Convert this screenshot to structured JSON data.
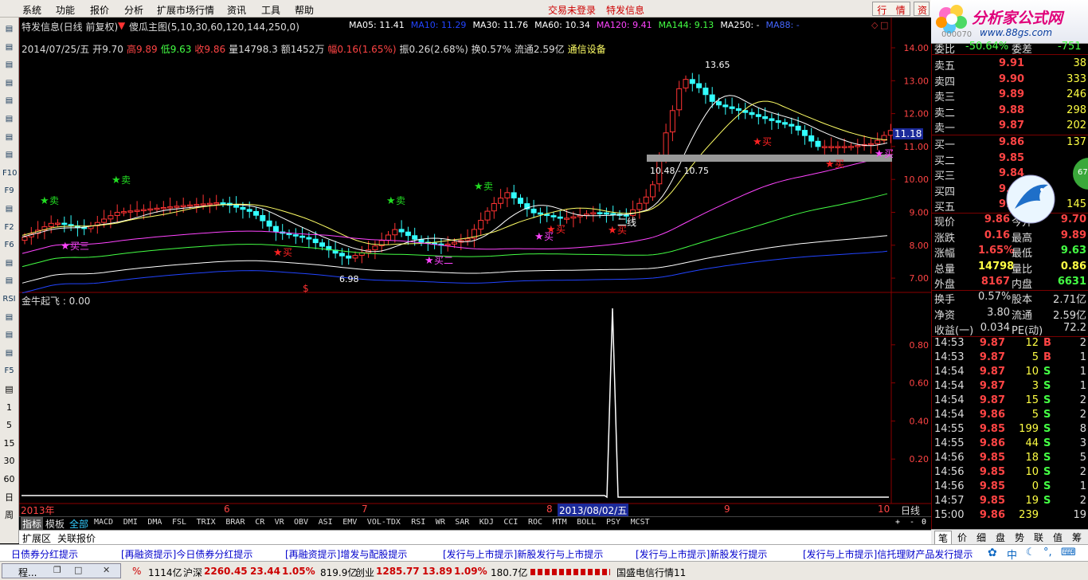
{
  "menu": {
    "items": [
      "系统",
      "功能",
      "报价",
      "分析",
      "扩展市场行情",
      "资讯",
      "工具",
      "帮助"
    ],
    "login": "交易未登录",
    "news": "特发信息",
    "btn1": "行",
    "btn2": "情",
    "btn3": "资"
  },
  "logo": {
    "text": "分析家公式网",
    "url": "www.88gs.com",
    "code": "000070"
  },
  "chart": {
    "title": "特发信息(日线 前复权)",
    "main_formula": "傻瓜主图",
    "main_params": "(5,10,30,60,120,144,250,0)",
    "ma_labels": [
      {
        "t": "MA05: 11.41",
        "c": "#ffffff"
      },
      {
        "t": "MA10: 11.29",
        "c": "#2244ff"
      },
      {
        "t": "MA30: 11.76",
        "c": "#ffffff"
      },
      {
        "t": "MA60: 10.34",
        "c": "#ffffff"
      },
      {
        "t": "MA120: 9.41",
        "c": "#ff44ff"
      },
      {
        "t": "MA144: 9.13",
        "c": "#44ff44"
      },
      {
        "t": "MA250: -",
        "c": "#ffffff"
      },
      {
        "t": "MA88: -",
        "c": "#4466ff"
      }
    ],
    "info": [
      {
        "t": "2014/07/25/五",
        "c": "#dddddd"
      },
      {
        "t": "开9.70",
        "c": "#dddddd"
      },
      {
        "t": "高9.89",
        "c": "#ff4444"
      },
      {
        "t": "低9.63",
        "c": "#44ff44"
      },
      {
        "t": "收9.86",
        "c": "#ff4444"
      },
      {
        "t": "量14798.3",
        "c": "#dddddd"
      },
      {
        "t": "额1452万",
        "c": "#dddddd"
      },
      {
        "t": "幅0.16(1.65%)",
        "c": "#ff4444"
      },
      {
        "t": "振0.26(2.68%)",
        "c": "#dddddd"
      },
      {
        "t": "换0.57%",
        "c": "#dddddd"
      },
      {
        "t": "流通2.59亿",
        "c": "#dddddd"
      },
      {
        "t": "通信设备",
        "c": "#ffff66"
      }
    ],
    "price_ticks": [
      "14.00",
      "13.00",
      "12.00",
      "11.00",
      "10.00",
      "9.00",
      "8.00",
      "7.00"
    ],
    "current_price_tag": "11.18",
    "annotations": {
      "high": "13.65",
      "low": "6.98",
      "range": "10.48 - 10.75",
      "erxian": "二线"
    },
    "signals": [
      {
        "t": "卖",
        "x": 62,
        "y": 252,
        "c": "#22dd22"
      },
      {
        "t": "卖",
        "x": 152,
        "y": 226,
        "c": "#22dd22"
      },
      {
        "t": "卖",
        "x": 497,
        "y": 252,
        "c": "#22dd22"
      },
      {
        "t": "卖",
        "x": 607,
        "y": 234,
        "c": "#22dd22"
      },
      {
        "t": "买三",
        "x": 88,
        "y": 309,
        "c": "#ff44ff"
      },
      {
        "t": "买",
        "x": 355,
        "y": 317,
        "c": "#ff2222"
      },
      {
        "t": "买二",
        "x": 545,
        "y": 327,
        "c": "#ff44ff"
      },
      {
        "t": "买",
        "x": 698,
        "y": 288,
        "c": "#ff2222"
      },
      {
        "t": "买",
        "x": 683,
        "y": 297,
        "c": "#ff44ff"
      },
      {
        "t": "买",
        "x": 775,
        "y": 289,
        "c": "#ff2222"
      },
      {
        "t": "买",
        "x": 957,
        "y": 178,
        "c": "#ff2222"
      },
      {
        "t": "买",
        "x": 1048,
        "y": 206,
        "c": "#ff2222"
      },
      {
        "t": "买",
        "x": 1110,
        "y": 193,
        "c": "#ff44ff"
      }
    ],
    "dollar": "$",
    "sub_title": "金牛起飞 : 0.00",
    "sub_ticks": [
      "0.80",
      "0.60",
      "0.40",
      "0.20"
    ],
    "x_labels": [
      {
        "t": "2013年",
        "c": "#ff4444"
      },
      {
        "t": "6",
        "c": "#ff4444"
      },
      {
        "t": "7",
        "c": "#ff4444"
      },
      {
        "t": "8",
        "c": "#ff4444"
      },
      {
        "t": "9",
        "c": "#ff4444"
      },
      {
        "t": "10",
        "c": "#ff4444"
      }
    ],
    "date_highlight": "2013/08/02/五",
    "sub_right": "日线"
  },
  "chart_data": {
    "type": "candlestick",
    "symbol": "特发信息",
    "yticks": [
      14,
      13,
      12,
      11,
      10,
      9,
      8,
      7
    ],
    "indicator": "金牛起飞",
    "indicator_ticks": [
      0.8,
      0.6,
      0.4,
      0.2
    ],
    "indicator_peak": 1.0
  },
  "tabs": {
    "left": [
      "指标",
      "模板",
      "全部"
    ],
    "indicators": [
      "MACD",
      "DMI",
      "DMA",
      "FSL",
      "TRIX",
      "BRAR",
      "CR",
      "VR",
      "OBV",
      "ASI",
      "EMV",
      "VOL-TDX",
      "RSI",
      "WR",
      "SAR",
      "KDJ",
      "CCI",
      "ROC",
      "MTM",
      "BOLL",
      "PSY",
      "MCST"
    ],
    "ext": [
      "扩展区",
      "关联报价"
    ],
    "right": [
      "+",
      "-",
      "0"
    ]
  },
  "orderbook": {
    "header": {
      "l": "委比",
      "v": "-50.64%",
      "l2": "委差",
      "v2": "-751"
    },
    "sell": [
      {
        "l": "卖五",
        "p": "9.91",
        "v": "38"
      },
      {
        "l": "卖四",
        "p": "9.90",
        "v": "333"
      },
      {
        "l": "卖三",
        "p": "9.89",
        "v": "246"
      },
      {
        "l": "卖二",
        "p": "9.88",
        "v": "298"
      },
      {
        "l": "卖一",
        "p": "9.87",
        "v": "202"
      }
    ],
    "buy": [
      {
        "l": "买一",
        "p": "9.86",
        "v": "137"
      },
      {
        "l": "买二",
        "p": "9.85",
        "v": ""
      },
      {
        "l": "买三",
        "p": "9.84",
        "v": ""
      },
      {
        "l": "买四",
        "p": "9.83",
        "v": ""
      },
      {
        "l": "买五",
        "p": "9.82",
        "v": "145"
      }
    ],
    "stats": [
      {
        "l": "现价",
        "v": "9.86",
        "vc": "#ff4444",
        "l2": "今开",
        "v2": "9.70",
        "v2c": "#ff4444"
      },
      {
        "l": "涨跌",
        "v": "0.16",
        "vc": "#ff4444",
        "l2": "最高",
        "v2": "9.89",
        "v2c": "#ff4444"
      },
      {
        "l": "涨幅",
        "v": "1.65%",
        "vc": "#ff4444",
        "l2": "最低",
        "v2": "9.63",
        "v2c": "#44ff44"
      },
      {
        "l": "总量",
        "v": "14798",
        "vc": "#ffff44",
        "l2": "量比",
        "v2": "0.86",
        "v2c": "#ffff44"
      },
      {
        "l": "外盘",
        "v": "8167",
        "vc": "#ff4444",
        "l2": "内盘",
        "v2": "6631",
        "v2c": "#44ff44"
      }
    ],
    "stats2": [
      {
        "l": "换手",
        "v": "0.57%",
        "l2": "股本",
        "v2": "2.71亿"
      },
      {
        "l": "净资",
        "v": "3.80",
        "l2": "流通",
        "v2": "2.59亿"
      },
      {
        "l": "收益(一)",
        "v": "0.034",
        "l2": "PE(动)",
        "v2": "72.2"
      }
    ],
    "ticks": [
      {
        "t": "14:53",
        "p": "9.87",
        "v": "12",
        "s": "B",
        "n": "2"
      },
      {
        "t": "14:53",
        "p": "9.87",
        "v": "5",
        "s": "B",
        "n": "1"
      },
      {
        "t": "14:54",
        "p": "9.87",
        "v": "10",
        "s": "S",
        "n": "1"
      },
      {
        "t": "14:54",
        "p": "9.87",
        "v": "3",
        "s": "S",
        "n": "1"
      },
      {
        "t": "14:54",
        "p": "9.87",
        "v": "15",
        "s": "S",
        "n": "2"
      },
      {
        "t": "14:54",
        "p": "9.86",
        "v": "5",
        "s": "S",
        "n": "2"
      },
      {
        "t": "14:55",
        "p": "9.85",
        "v": "199",
        "s": "S",
        "n": "8"
      },
      {
        "t": "14:55",
        "p": "9.86",
        "v": "44",
        "s": "S",
        "n": "3"
      },
      {
        "t": "14:56",
        "p": "9.85",
        "v": "18",
        "s": "S",
        "n": "5"
      },
      {
        "t": "14:56",
        "p": "9.85",
        "v": "10",
        "s": "S",
        "n": "2"
      },
      {
        "t": "14:56",
        "p": "9.85",
        "v": "0",
        "s": "S",
        "n": "1"
      },
      {
        "t": "14:57",
        "p": "9.85",
        "v": "19",
        "s": "S",
        "n": "2"
      },
      {
        "t": "15:00",
        "p": "9.86",
        "v": "239",
        "s": "",
        "n": "19"
      }
    ],
    "circle_text": "67"
  },
  "right_tabs": [
    "笔",
    "价",
    "细",
    "盘",
    "势",
    "联",
    "值",
    "筹"
  ],
  "ticker": [
    "[再融资提示]今日债券分红提示",
    "[再融资提示]增发与配股提示",
    "[发行与上市提示]新股发行与上市提示",
    "[发行与上市提示]新股发行提示",
    "[发行与上市提示]信托理财产品发行提示"
  ],
  "ticker_left": "日债券分红提示",
  "status": {
    "win_label": "程...",
    "pct": "%",
    "amount": "1114亿",
    "sh_label": "沪深",
    "sh_val": "2260.45",
    "sh_chg": "23.44",
    "sh_pct": "1.05%",
    "sh_amt": "819.9亿",
    "cy_label": "创业",
    "cy_val": "1285.77",
    "cy_chg": "13.89",
    "cy_pct": "1.09%",
    "cy_amt": "180.7亿",
    "scroll": "国盛电信行情11"
  },
  "toolbar_icons": [
    "arrow-up-icon",
    "arrow-down-icon",
    "gear-icon",
    "kline-icon",
    "grid-icon",
    "chart-icon",
    "bar-icon",
    "table-icon",
    "F10",
    "F9",
    "quote-icon",
    "F2",
    "F6",
    "scope-icon",
    "line-icon",
    "RSI",
    "dollar-icon",
    "move-icon",
    "pen-icon",
    "F5",
    "scroll-icon",
    "1",
    "5",
    "15",
    "30",
    "60",
    "日",
    "周"
  ],
  "colors": {
    "up": "#ff3333",
    "down": "#33ffff",
    "bg": "#000000",
    "axis": "#8b0000"
  }
}
